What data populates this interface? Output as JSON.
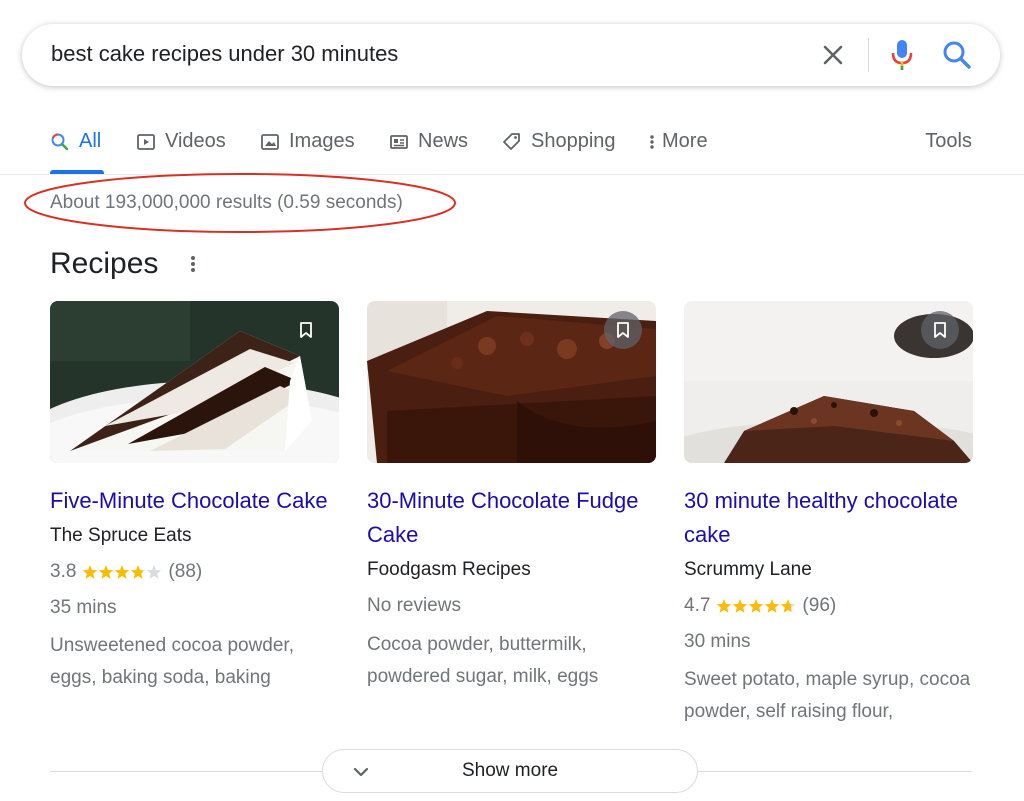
{
  "search": {
    "query": "best cake recipes under 30 minutes",
    "icons": {
      "clear": "close-icon",
      "mic": "microphone-icon",
      "search": "search-icon"
    }
  },
  "tabs": [
    {
      "label": "All",
      "icon": "search-icon",
      "active": true
    },
    {
      "label": "Videos",
      "icon": "play-icon"
    },
    {
      "label": "Images",
      "icon": "image-icon"
    },
    {
      "label": "News",
      "icon": "news-icon"
    },
    {
      "label": "Shopping",
      "icon": "tag-icon"
    },
    {
      "label": "More",
      "icon": "more-vertical-icon"
    }
  ],
  "tools_label": "Tools",
  "result_stats": "About 193,000,000 results (0.59 seconds)",
  "recipes": {
    "heading": "Recipes",
    "cards": [
      {
        "title": "Five-Minute Chocolate Cake",
        "source": "The Spruce Eats",
        "rating": "3.8",
        "stars": 3.8,
        "reviews": "(88)",
        "time": "35 mins",
        "ingredients": "Unsweetened cocoa powder, eggs, baking soda, baking"
      },
      {
        "title": "30-Minute Chocolate Fudge Cake",
        "source": "Foodgasm Recipes",
        "no_reviews": "No reviews",
        "ingredients": "Cocoa powder, buttermilk, powdered sugar, milk, eggs"
      },
      {
        "title": "30 minute healthy chocolate cake",
        "source": "Scrummy Lane",
        "rating": "4.7",
        "stars": 4.7,
        "reviews": "(96)",
        "time": "30 mins",
        "ingredients": "Sweet potato, maple syrup, cocoa powder, self raising flour,"
      }
    ]
  },
  "show_more_label": "Show more",
  "colors": {
    "link": "#1a0dab",
    "accent": "#1a73e8",
    "star": "#fbbc04",
    "highlight": "#d93025"
  }
}
